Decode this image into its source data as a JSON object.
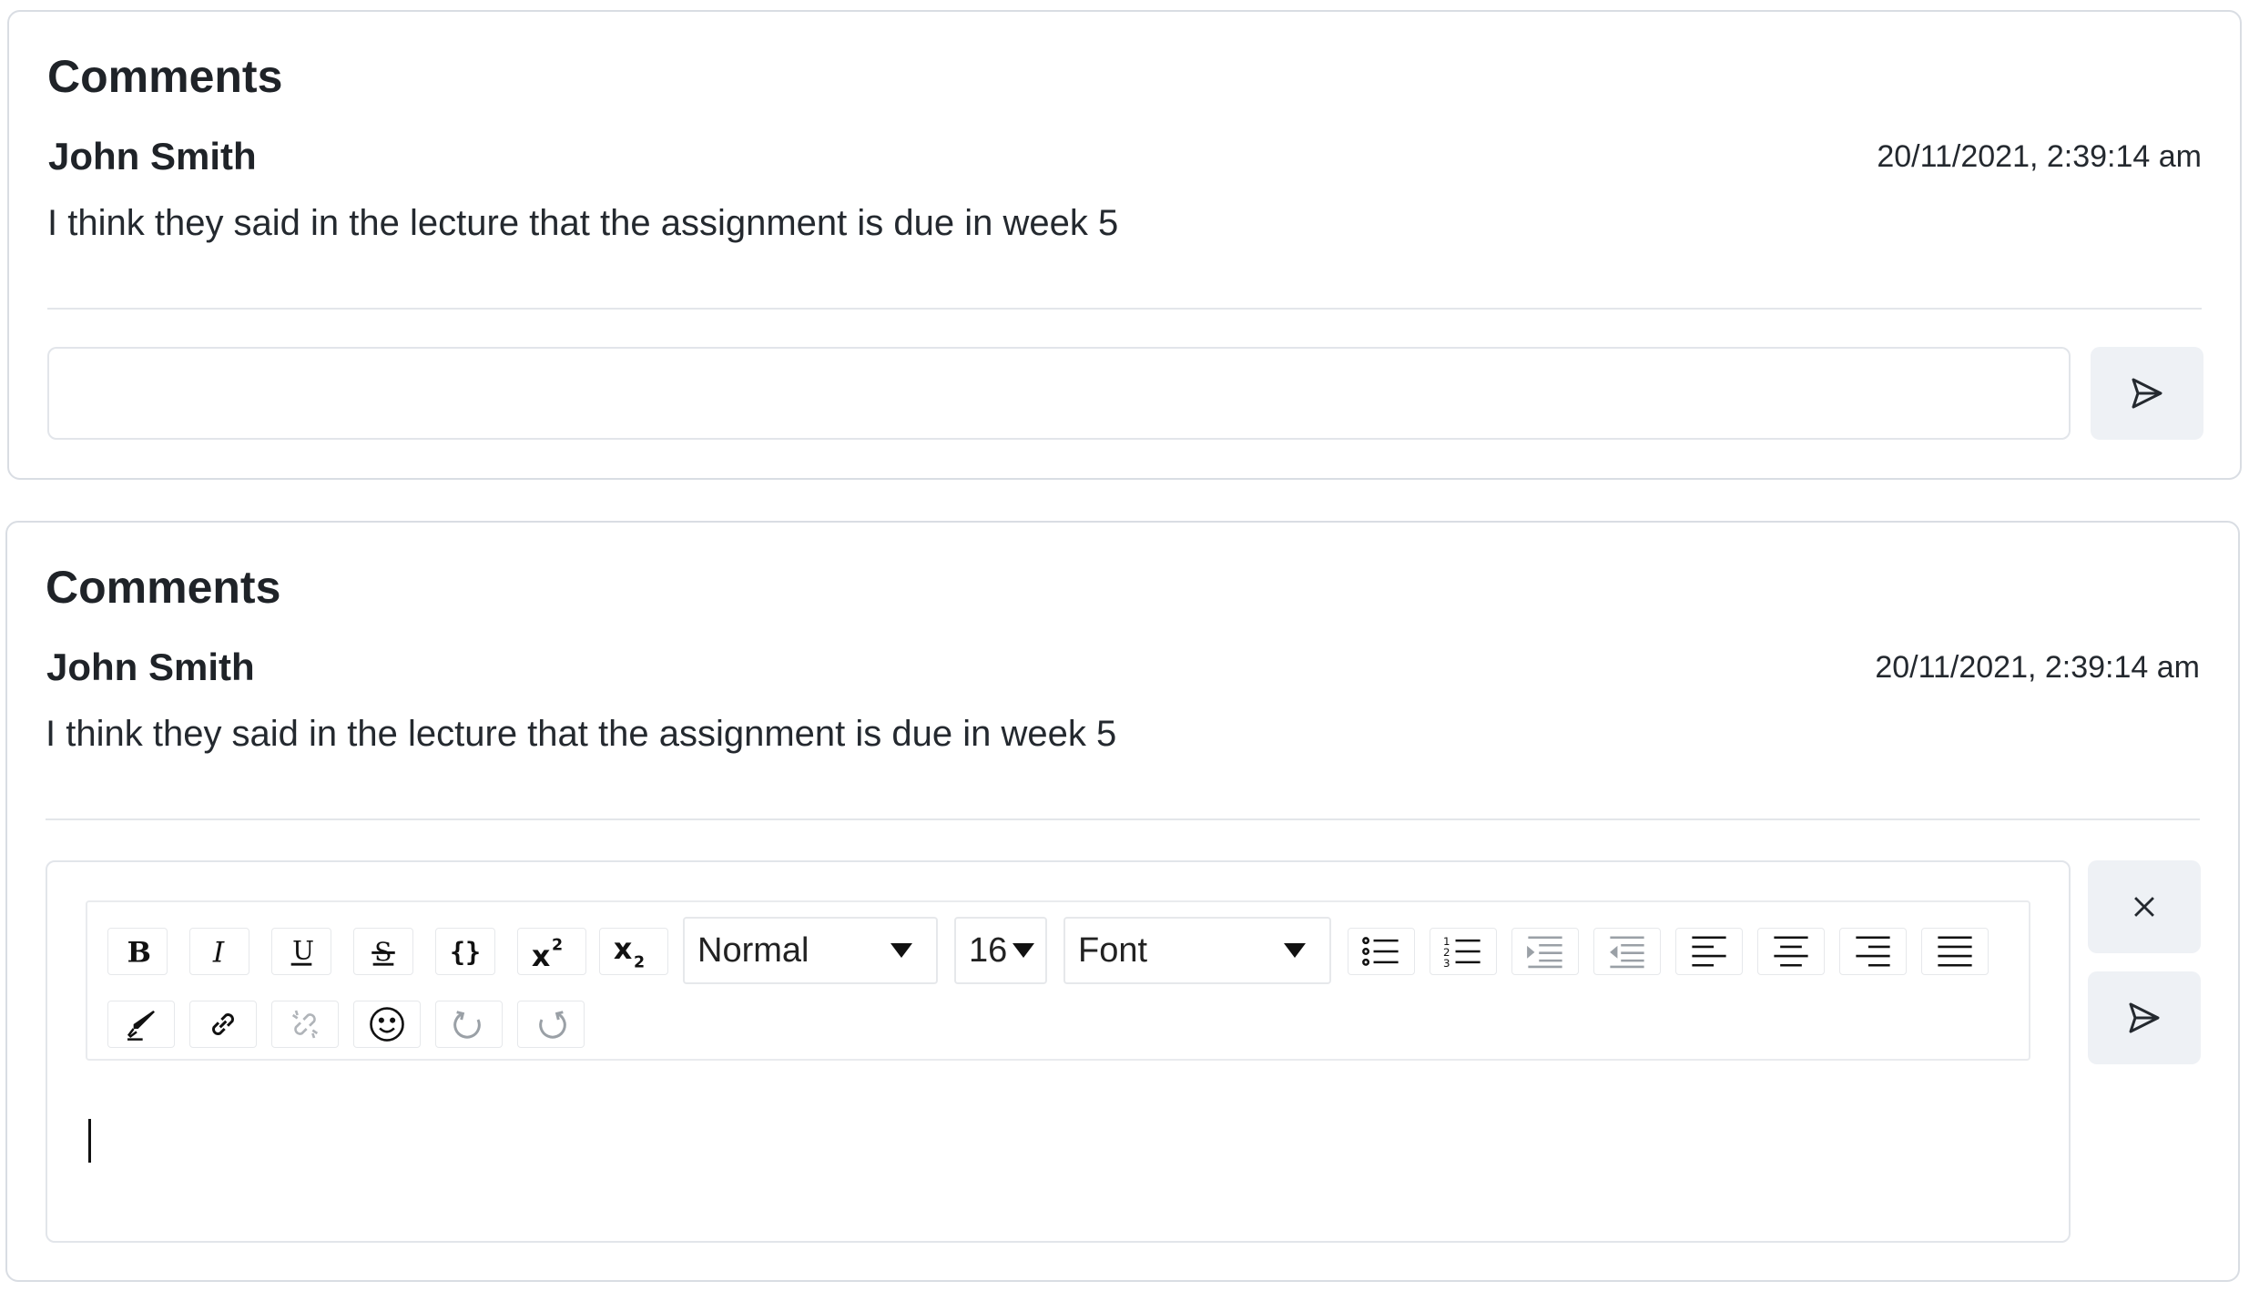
{
  "panels": [
    {
      "title": "Comments",
      "comment": {
        "author": "John Smith",
        "timestamp": "20/11/2021, 2:39:14 am",
        "text": "I think they said in the lecture that the assignment is due in week 5"
      },
      "input": {
        "placeholder": "",
        "value": ""
      },
      "buttons": {
        "send_icon": "send-icon"
      }
    },
    {
      "title": "Comments",
      "comment": {
        "author": "John Smith",
        "timestamp": "20/11/2021, 2:39:14 am",
        "text": "I think they said in the lecture that the assignment is due in week 5"
      },
      "editor": {
        "toolbar": {
          "buttons_row1": [
            "bold-icon",
            "italic-icon",
            "underline-icon",
            "strikethrough-icon",
            "code-icon",
            "superscript-icon",
            "subscript-icon"
          ],
          "block_format": "Normal",
          "font_size": "16",
          "font_family": "Font",
          "buttons_row1b": [
            "bulleted-list-icon",
            "numbered-list-icon",
            "indent-icon",
            "outdent-icon",
            "align-left-icon",
            "align-center-icon",
            "align-right-icon",
            "justify-icon"
          ],
          "buttons_row2": [
            "eyedropper-icon",
            "link-icon",
            "unlink-icon",
            "emoji-icon",
            "undo-icon",
            "redo-icon"
          ]
        },
        "content": ""
      },
      "buttons": {
        "close_icon": "close-icon",
        "send_icon": "send-icon"
      }
    }
  ]
}
